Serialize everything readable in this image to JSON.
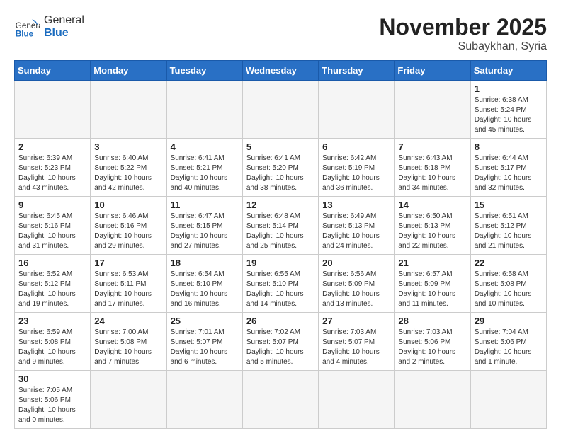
{
  "header": {
    "logo_general": "General",
    "logo_blue": "Blue",
    "month_title": "November 2025",
    "location": "Subaykhan, Syria"
  },
  "days_of_week": [
    "Sunday",
    "Monday",
    "Tuesday",
    "Wednesday",
    "Thursday",
    "Friday",
    "Saturday"
  ],
  "weeks": [
    [
      {
        "day": "",
        "info": ""
      },
      {
        "day": "",
        "info": ""
      },
      {
        "day": "",
        "info": ""
      },
      {
        "day": "",
        "info": ""
      },
      {
        "day": "",
        "info": ""
      },
      {
        "day": "",
        "info": ""
      },
      {
        "day": "1",
        "info": "Sunrise: 6:38 AM\nSunset: 5:24 PM\nDaylight: 10 hours and 45 minutes."
      }
    ],
    [
      {
        "day": "2",
        "info": "Sunrise: 6:39 AM\nSunset: 5:23 PM\nDaylight: 10 hours and 43 minutes."
      },
      {
        "day": "3",
        "info": "Sunrise: 6:40 AM\nSunset: 5:22 PM\nDaylight: 10 hours and 42 minutes."
      },
      {
        "day": "4",
        "info": "Sunrise: 6:41 AM\nSunset: 5:21 PM\nDaylight: 10 hours and 40 minutes."
      },
      {
        "day": "5",
        "info": "Sunrise: 6:41 AM\nSunset: 5:20 PM\nDaylight: 10 hours and 38 minutes."
      },
      {
        "day": "6",
        "info": "Sunrise: 6:42 AM\nSunset: 5:19 PM\nDaylight: 10 hours and 36 minutes."
      },
      {
        "day": "7",
        "info": "Sunrise: 6:43 AM\nSunset: 5:18 PM\nDaylight: 10 hours and 34 minutes."
      },
      {
        "day": "8",
        "info": "Sunrise: 6:44 AM\nSunset: 5:17 PM\nDaylight: 10 hours and 32 minutes."
      }
    ],
    [
      {
        "day": "9",
        "info": "Sunrise: 6:45 AM\nSunset: 5:16 PM\nDaylight: 10 hours and 31 minutes."
      },
      {
        "day": "10",
        "info": "Sunrise: 6:46 AM\nSunset: 5:16 PM\nDaylight: 10 hours and 29 minutes."
      },
      {
        "day": "11",
        "info": "Sunrise: 6:47 AM\nSunset: 5:15 PM\nDaylight: 10 hours and 27 minutes."
      },
      {
        "day": "12",
        "info": "Sunrise: 6:48 AM\nSunset: 5:14 PM\nDaylight: 10 hours and 25 minutes."
      },
      {
        "day": "13",
        "info": "Sunrise: 6:49 AM\nSunset: 5:13 PM\nDaylight: 10 hours and 24 minutes."
      },
      {
        "day": "14",
        "info": "Sunrise: 6:50 AM\nSunset: 5:13 PM\nDaylight: 10 hours and 22 minutes."
      },
      {
        "day": "15",
        "info": "Sunrise: 6:51 AM\nSunset: 5:12 PM\nDaylight: 10 hours and 21 minutes."
      }
    ],
    [
      {
        "day": "16",
        "info": "Sunrise: 6:52 AM\nSunset: 5:12 PM\nDaylight: 10 hours and 19 minutes."
      },
      {
        "day": "17",
        "info": "Sunrise: 6:53 AM\nSunset: 5:11 PM\nDaylight: 10 hours and 17 minutes."
      },
      {
        "day": "18",
        "info": "Sunrise: 6:54 AM\nSunset: 5:10 PM\nDaylight: 10 hours and 16 minutes."
      },
      {
        "day": "19",
        "info": "Sunrise: 6:55 AM\nSunset: 5:10 PM\nDaylight: 10 hours and 14 minutes."
      },
      {
        "day": "20",
        "info": "Sunrise: 6:56 AM\nSunset: 5:09 PM\nDaylight: 10 hours and 13 minutes."
      },
      {
        "day": "21",
        "info": "Sunrise: 6:57 AM\nSunset: 5:09 PM\nDaylight: 10 hours and 11 minutes."
      },
      {
        "day": "22",
        "info": "Sunrise: 6:58 AM\nSunset: 5:08 PM\nDaylight: 10 hours and 10 minutes."
      }
    ],
    [
      {
        "day": "23",
        "info": "Sunrise: 6:59 AM\nSunset: 5:08 PM\nDaylight: 10 hours and 9 minutes."
      },
      {
        "day": "24",
        "info": "Sunrise: 7:00 AM\nSunset: 5:08 PM\nDaylight: 10 hours and 7 minutes."
      },
      {
        "day": "25",
        "info": "Sunrise: 7:01 AM\nSunset: 5:07 PM\nDaylight: 10 hours and 6 minutes."
      },
      {
        "day": "26",
        "info": "Sunrise: 7:02 AM\nSunset: 5:07 PM\nDaylight: 10 hours and 5 minutes."
      },
      {
        "day": "27",
        "info": "Sunrise: 7:03 AM\nSunset: 5:07 PM\nDaylight: 10 hours and 4 minutes."
      },
      {
        "day": "28",
        "info": "Sunrise: 7:03 AM\nSunset: 5:06 PM\nDaylight: 10 hours and 2 minutes."
      },
      {
        "day": "29",
        "info": "Sunrise: 7:04 AM\nSunset: 5:06 PM\nDaylight: 10 hours and 1 minute."
      }
    ],
    [
      {
        "day": "30",
        "info": "Sunrise: 7:05 AM\nSunset: 5:06 PM\nDaylight: 10 hours and 0 minutes."
      },
      {
        "day": "",
        "info": ""
      },
      {
        "day": "",
        "info": ""
      },
      {
        "day": "",
        "info": ""
      },
      {
        "day": "",
        "info": ""
      },
      {
        "day": "",
        "info": ""
      },
      {
        "day": "",
        "info": ""
      }
    ]
  ]
}
